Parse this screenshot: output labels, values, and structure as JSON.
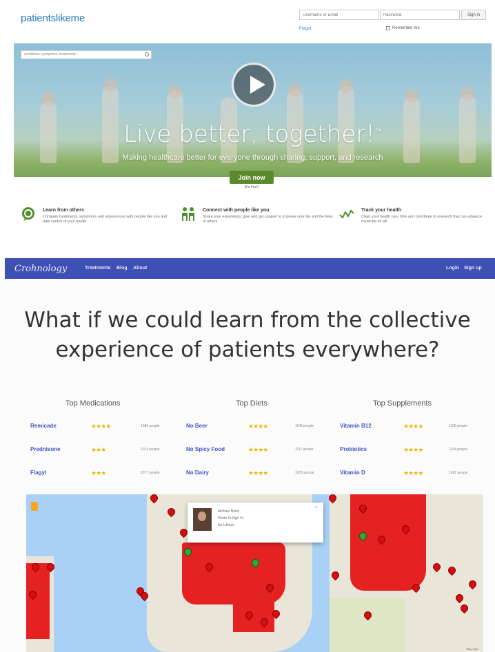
{
  "plm": {
    "logo": "patientslikeme",
    "username_placeholder": "Username or Email",
    "password_placeholder": "Password",
    "signin_label": "Sign in",
    "forgot_label": "Forgot",
    "remember_label": "Remember me",
    "search_placeholder": "conditions, symptoms, treatments...",
    "hero_title": "Live better, together!",
    "hero_trademark": "™",
    "hero_subtitle": "Making healthcare better for everyone through sharing, support, and research",
    "join_label": "Join now",
    "free_label": "(it's free!)",
    "features": [
      {
        "title": "Learn from others",
        "desc": "Compare treatments, symptoms and experiences with people like you and take control of your health"
      },
      {
        "title": "Connect with people like you",
        "desc": "Share your experience, give and get support to improve your life and the lives of others"
      },
      {
        "title": "Track your health",
        "desc": "Chart your health over time and contribute to research that can advance medicine for all"
      }
    ]
  },
  "crohn": {
    "logo": "Crohnology",
    "nav_links": [
      "Treatments",
      "Blog",
      "About"
    ],
    "nav_right": [
      "Login",
      "Sign up"
    ],
    "headline_1": "What if we could learn from the collective",
    "headline_2": "experience of patients everywhere?",
    "columns": [
      {
        "heading": "Top Medications",
        "rows": [
          {
            "name": "Remicade",
            "stars": "★★★★",
            "count": "1086 people"
          },
          {
            "name": "Prednisone",
            "stars": "★★★",
            "count": "1014 people"
          },
          {
            "name": "Flagyl",
            "stars": "★★★",
            "count": "1077 people"
          }
        ]
      },
      {
        "heading": "Top Diets",
        "rows": [
          {
            "name": "No Beer",
            "stars": "★★★★",
            "count": "1148 people"
          },
          {
            "name": "No Spicy Food",
            "stars": "★★★★",
            "count": "1111 people"
          },
          {
            "name": "No Dairy",
            "stars": "★★★★",
            "count": "1076 people"
          }
        ]
      },
      {
        "heading": "Top Supplements",
        "rows": [
          {
            "name": "Vitamin B12",
            "stars": "★★★★",
            "count": "1105 people"
          },
          {
            "name": "Probiotics",
            "stars": "★★★★",
            "count": "1104 people"
          },
          {
            "name": "Vitamin D",
            "stars": "★★★★",
            "count": "1061 people"
          }
        ]
      }
    ],
    "tooltip": {
      "line1": "Michael Hann",
      "line2": "Photo Dr Ngo Yu",
      "line3": "No Lithium"
    },
    "map_attribution": "Map data"
  },
  "colors": {
    "plm_blue": "#2a7ab8",
    "plm_green": "#5a8a2c",
    "crohn_nav": "#3e4fb5",
    "crohn_link": "#3f56c3",
    "star": "#e6b800",
    "pin_red": "#d50f0f",
    "pin_green": "#2cab3b"
  }
}
